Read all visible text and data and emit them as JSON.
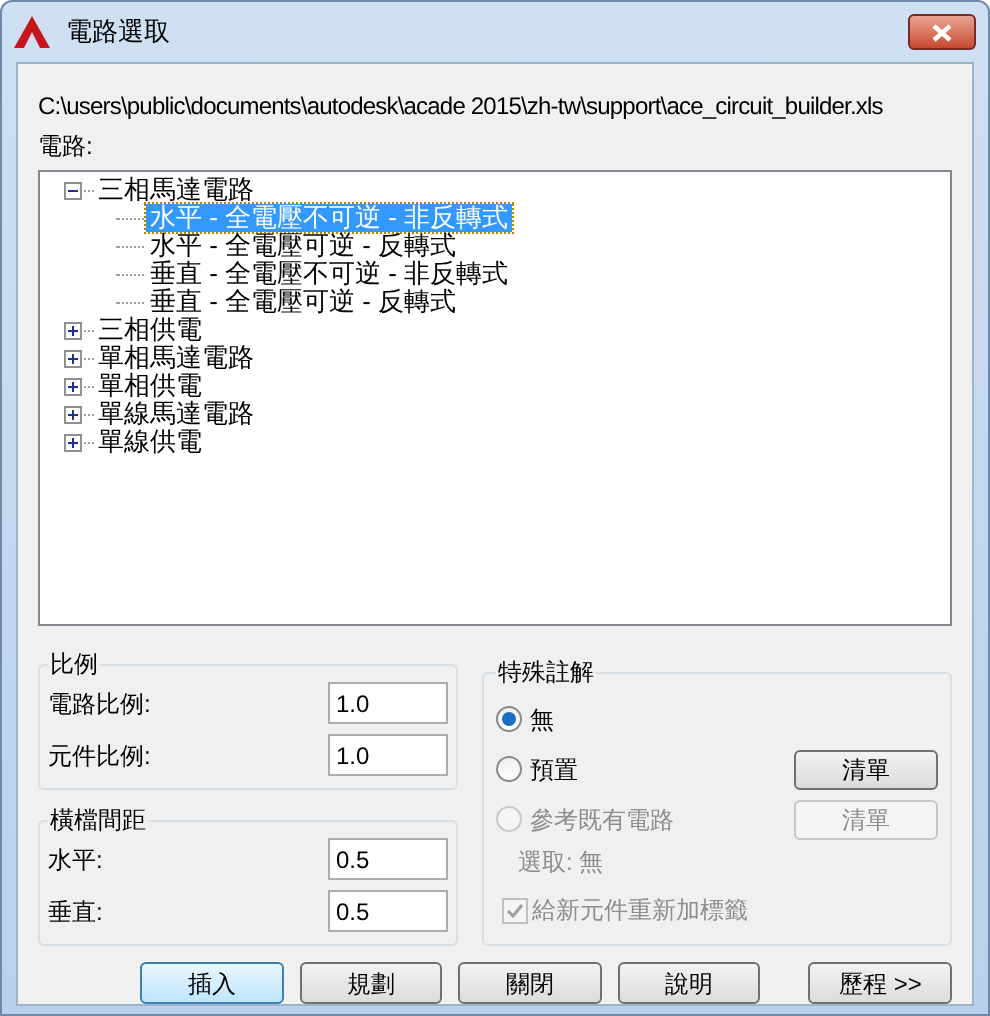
{
  "window": {
    "title": "電路選取"
  },
  "path": "C:\\users\\public\\documents\\autodesk\\acade 2015\\zh-tw\\support\\ace_circuit_builder.xls",
  "circuits_label": "電路:",
  "tree": [
    {
      "label": "三相馬達電路",
      "expanded": true,
      "selected": false,
      "children": [
        {
          "label": "水平 - 全電壓不可逆 - 非反轉式",
          "selected": true
        },
        {
          "label": "水平 - 全電壓可逆 - 反轉式",
          "selected": false
        },
        {
          "label": "垂直 - 全電壓不可逆 - 非反轉式",
          "selected": false
        },
        {
          "label": "垂直 - 全電壓可逆 - 反轉式",
          "selected": false
        }
      ]
    },
    {
      "label": "三相供電",
      "expanded": false,
      "selected": false
    },
    {
      "label": "單相馬達電路",
      "expanded": false,
      "selected": false
    },
    {
      "label": "單相供電",
      "expanded": false,
      "selected": false
    },
    {
      "label": "單線馬達電路",
      "expanded": false,
      "selected": false
    },
    {
      "label": "單線供電",
      "expanded": false,
      "selected": false
    }
  ],
  "scale": {
    "title": "比例",
    "fields": [
      {
        "label": "電路比例:",
        "value": "1.0"
      },
      {
        "label": "元件比例:",
        "value": "1.0"
      }
    ]
  },
  "spacing": {
    "title": "橫檔間距",
    "fields": [
      {
        "label": "水平:",
        "value": "0.5"
      },
      {
        "label": "垂直:",
        "value": "0.5"
      }
    ]
  },
  "annotation": {
    "title": "特殊註解",
    "options": [
      {
        "label": "無",
        "selected": true,
        "disabled": false
      },
      {
        "label": "預置",
        "selected": false,
        "disabled": false,
        "button": {
          "label": "清單",
          "disabled": false
        }
      },
      {
        "label": "參考既有電路",
        "selected": false,
        "disabled": true,
        "button": {
          "label": "清單",
          "disabled": true
        }
      }
    ],
    "selection_text": "選取: 無",
    "relabel": {
      "label": "給新元件重新加標籤",
      "checked": true,
      "disabled": true
    }
  },
  "buttons": [
    {
      "label": "插入",
      "default": true
    },
    {
      "label": "規劃",
      "default": false
    },
    {
      "label": "關閉",
      "default": false
    },
    {
      "label": "說明",
      "default": false
    },
    {
      "label": "歷程 >>",
      "default": false
    }
  ]
}
